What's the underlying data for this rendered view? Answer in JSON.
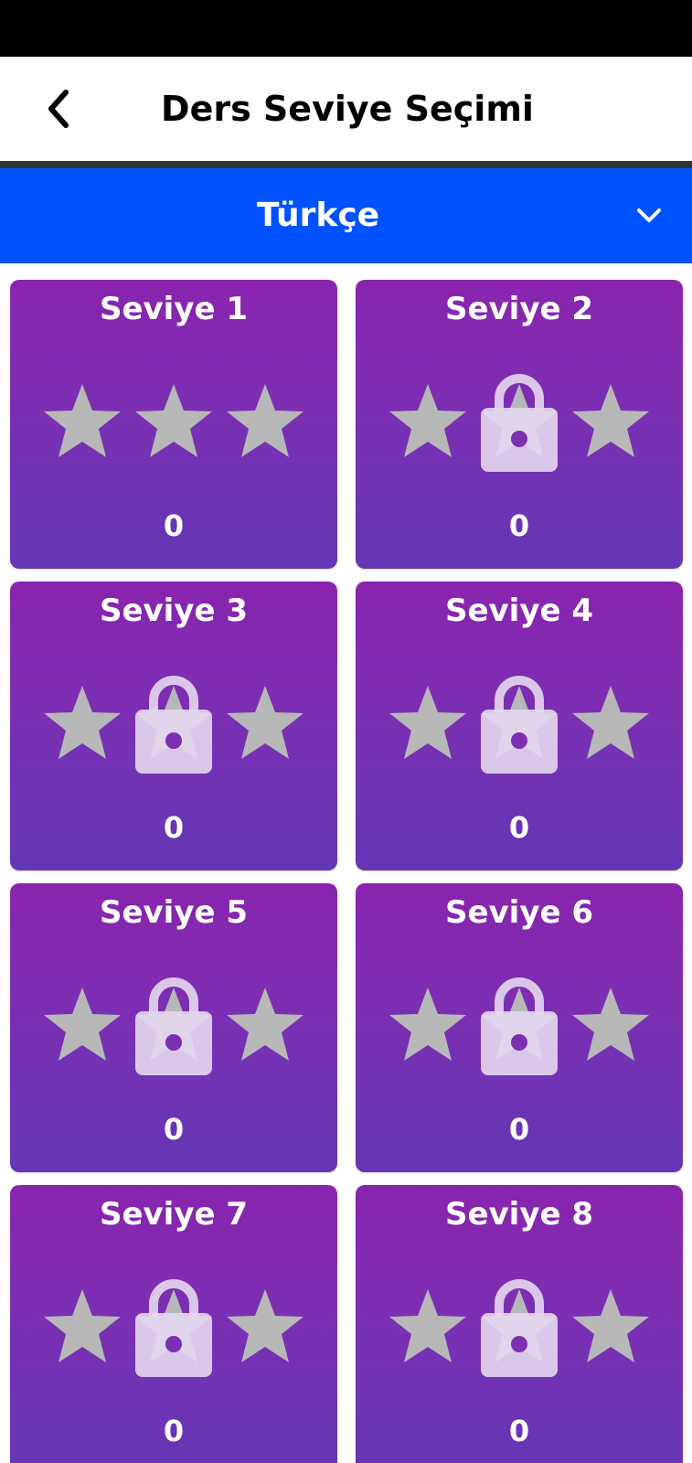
{
  "app_bar": {
    "title": "Ders Seviye Seçimi",
    "back_icon": "chevron-left-icon"
  },
  "subject_select": {
    "selected": "Türkçe",
    "icon": "chevron-down-icon"
  },
  "colors": {
    "status_bar": "#000000",
    "subject_bar": "#0052ff",
    "card_gradient_top": "#8a24ae",
    "card_gradient_bottom": "#6436b5",
    "star": "#b8b8b8",
    "lock": "#e4d8ef"
  },
  "levels": [
    {
      "title": "Seviye 1",
      "score": "0",
      "locked": false,
      "stars_earned": 0,
      "stars_total": 3
    },
    {
      "title": "Seviye 2",
      "score": "0",
      "locked": true,
      "stars_earned": 0,
      "stars_total": 3
    },
    {
      "title": "Seviye 3",
      "score": "0",
      "locked": true,
      "stars_earned": 0,
      "stars_total": 3
    },
    {
      "title": "Seviye 4",
      "score": "0",
      "locked": true,
      "stars_earned": 0,
      "stars_total": 3
    },
    {
      "title": "Seviye 5",
      "score": "0",
      "locked": true,
      "stars_earned": 0,
      "stars_total": 3
    },
    {
      "title": "Seviye 6",
      "score": "0",
      "locked": true,
      "stars_earned": 0,
      "stars_total": 3
    },
    {
      "title": "Seviye 7",
      "score": "0",
      "locked": true,
      "stars_earned": 0,
      "stars_total": 3
    },
    {
      "title": "Seviye 8",
      "score": "0",
      "locked": true,
      "stars_earned": 0,
      "stars_total": 3
    }
  ]
}
